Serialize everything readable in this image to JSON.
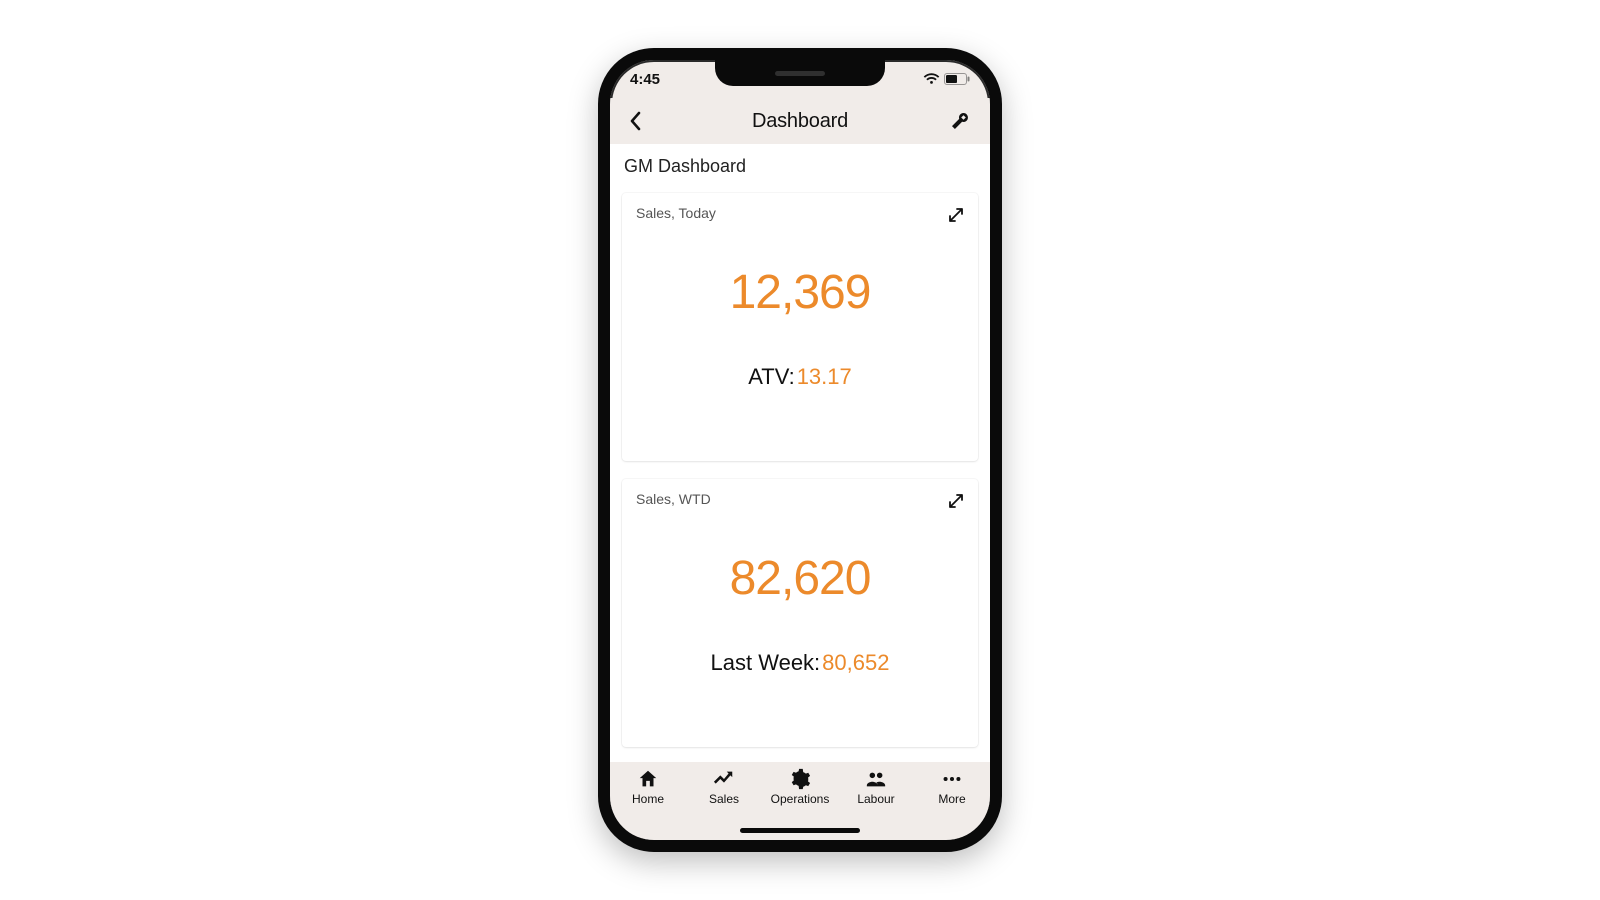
{
  "status": {
    "time": "4:45"
  },
  "nav": {
    "title": "Dashboard"
  },
  "section": {
    "title": "GM Dashboard"
  },
  "cards": [
    {
      "title": "Sales, Today",
      "value": "12,369",
      "sub_label": "ATV:",
      "sub_value": "13.17"
    },
    {
      "title": "Sales, WTD",
      "value": "82,620",
      "sub_label": "Last Week:",
      "sub_value": "80,652"
    }
  ],
  "tabs": {
    "home": "Home",
    "sales": "Sales",
    "operations": "Operations",
    "labour": "Labour",
    "more": "More"
  },
  "colors": {
    "accent": "#ec8a2b"
  }
}
